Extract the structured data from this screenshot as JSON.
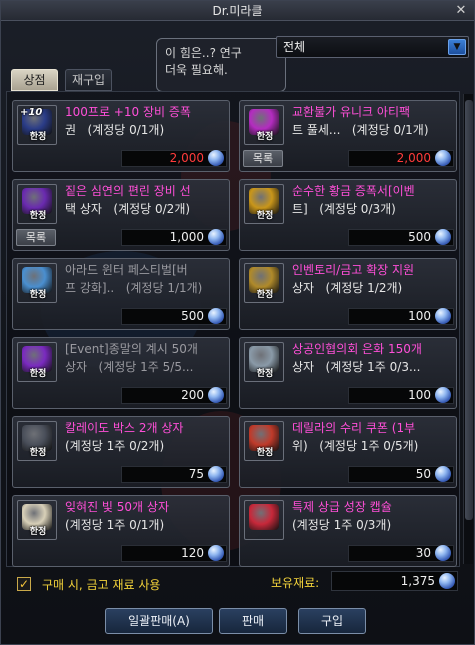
{
  "window": {
    "title": "Dr.미라클"
  },
  "tooltip": {
    "text": "이 힘은..? 연구\n더욱 필요해."
  },
  "filter": {
    "selected": "전체"
  },
  "tabs": [
    {
      "label": "상점",
      "active": true
    },
    {
      "label": "재구입",
      "active": false
    }
  ],
  "items": [
    {
      "name1": "100프로 +10 장비 증폭",
      "name2": "권",
      "account_limit": "(계정당 0/1개)",
      "price": "2,000",
      "price_color": "red",
      "badge": "한정",
      "plus": "+10",
      "has_list_button": false,
      "icon_color": "#2a3c88",
      "name_gray": false
    },
    {
      "name1": "교환불가 유니크 아티팩",
      "name2": "트 풀세...",
      "account_limit": "(계정당 0/1개)",
      "price": "2,000",
      "price_color": "red",
      "badge": "한정",
      "plus": "",
      "has_list_button": true,
      "icon_color": "#b42cc0",
      "name_gray": false
    },
    {
      "name1": "짙은 심연의 편린 장비 선",
      "name2": "택 상자",
      "account_limit": "(계정당 0/2개)",
      "price": "1,000",
      "price_color": "white",
      "badge": "한정",
      "plus": "",
      "has_list_button": true,
      "icon_color": "#6a2ab0",
      "name_gray": false
    },
    {
      "name1": "순수한 황금 증폭서[이벤",
      "name2": "트]",
      "account_limit": "(계정당 0/3개)",
      "price": "500",
      "price_color": "white",
      "badge": "한정",
      "plus": "",
      "has_list_button": false,
      "icon_color": "#c9961a",
      "name_gray": false
    },
    {
      "name1": "아라드 윈터 페스티벌[버",
      "name2": "프 강화]..",
      "account_limit": "(계정당 1/1개)",
      "price": "500",
      "price_color": "white",
      "badge": "한정",
      "plus": "",
      "has_list_button": false,
      "icon_color": "#4a8fd0",
      "name_gray": true
    },
    {
      "name1": "인벤토리/금고 확장 지원",
      "name2": "상자",
      "account_limit": "(계정당 1/2개)",
      "price": "100",
      "price_color": "white",
      "badge": "한정",
      "plus": "",
      "has_list_button": false,
      "icon_color": "#b08a2a",
      "name_gray": false
    },
    {
      "name1": "[Event]종말의 계시 50개",
      "name2": "상자",
      "account_limit": "(계정당 1주 5/5...",
      "price": "200",
      "price_color": "white",
      "badge": "한정",
      "plus": "",
      "has_list_button": false,
      "icon_color": "#7a2ac0",
      "name_gray": true
    },
    {
      "name1": "상공인협의회 은화 150개",
      "name2": "상자",
      "account_limit": "(계정당 1주 0/3...",
      "price": "100",
      "price_color": "white",
      "badge": "한정",
      "plus": "",
      "has_list_button": false,
      "icon_color": "#8a9aa8",
      "name_gray": false
    },
    {
      "name1": "칼레이도 박스 2개 상자",
      "name2": "",
      "account_limit": "(계정당 1주 0/2개)",
      "price": "75",
      "price_color": "white",
      "badge": "한정",
      "plus": "",
      "has_list_button": false,
      "icon_color": "#4a4f5a",
      "name_gray": false
    },
    {
      "name1": "데릴라의 수리 쿠폰 (1부",
      "name2": "위)",
      "account_limit": "(계정당 1주 0/5개)",
      "price": "50",
      "price_color": "white",
      "badge": "한정",
      "plus": "",
      "has_list_button": false,
      "icon_color": "#c03a2a",
      "name_gray": false
    },
    {
      "name1": "잊혀진 빛 50개 상자",
      "name2": "",
      "account_limit": "(계정당 1주 0/1개)",
      "price": "120",
      "price_color": "white",
      "badge": "한정",
      "plus": "",
      "has_list_button": false,
      "icon_color": "#d8d0b8",
      "name_gray": false
    },
    {
      "name1": "특제 상급 성장 캡슐",
      "name2": "",
      "account_limit": "(계정당 1주 0/3개)",
      "price": "30",
      "price_color": "white",
      "badge": "",
      "plus": "",
      "has_list_button": false,
      "icon_color": "#c8283a",
      "name_gray": false
    }
  ],
  "list_button_label": "목록",
  "checkbox": {
    "label": "구매 시, 금고 재료 사용",
    "checked": true,
    "check_mark": "✓"
  },
  "holdings": {
    "label": "보유재료:",
    "value": "1,375"
  },
  "buttons": {
    "bulk_sell": "일괄판매(A)",
    "sell": "판매",
    "buy": "구입"
  },
  "colors": {
    "name_pink": "#ff4fd8",
    "price_red": "#ff3b3b",
    "label_yellow": "#f2d23a"
  }
}
